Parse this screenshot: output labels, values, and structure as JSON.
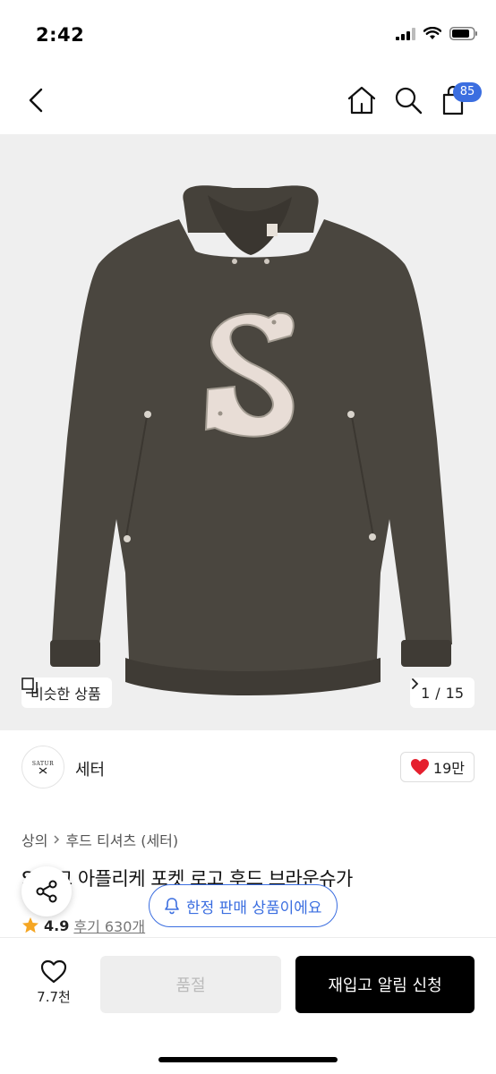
{
  "status_bar": {
    "time": "2:42"
  },
  "nav": {
    "cart_count": "85"
  },
  "hero": {
    "similar_label": "비슷한 상품",
    "page_current": "1",
    "page_sep": "/",
    "page_total": "15"
  },
  "brand": {
    "logo_text": "SATUR",
    "name": "세터",
    "likes": "19만"
  },
  "product": {
    "breadcrumb": [
      "상의",
      "후드 티셔츠 (세터)"
    ],
    "title": "S 로고 아플리케 포켓 로고 후드 브라운슈가",
    "rating": "4.9",
    "reviews": "후기 630개"
  },
  "toast": {
    "limited_label": "한정 판매 상품이에요"
  },
  "bottom": {
    "wish_count": "7.7천",
    "soldout_label": "품절",
    "restock_label": "재입고 알림 신청"
  },
  "colors": {
    "accent": "#3b6ee0",
    "heart": "#e5202e",
    "star": "#f5a623",
    "hoodie": "#4a463f",
    "logo_fill": "#e8ddd6"
  }
}
